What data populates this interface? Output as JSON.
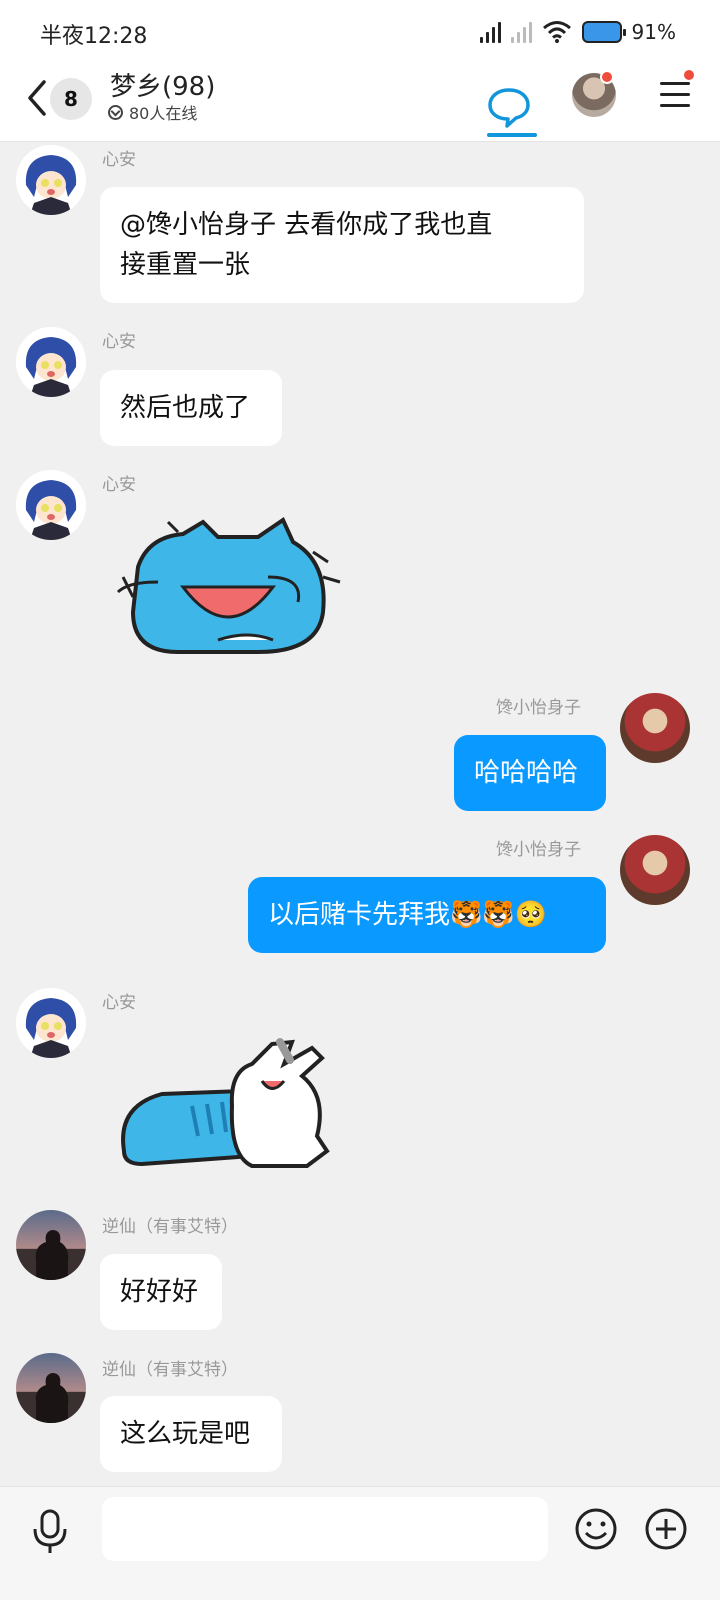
{
  "status": {
    "time": "半夜12:28",
    "battery": "91%"
  },
  "header": {
    "back_badge": "8",
    "title": "梦乡(98)",
    "online": "80人在线"
  },
  "messages": [
    {
      "sender": "心安",
      "text": "@馋小怡身子 去看你成了我也直接重置一张",
      "line1": "@馋小怡身子 去看你成了我也直",
      "line2": "接重置一张"
    },
    {
      "sender": "心安",
      "text": "然后也成了"
    },
    {
      "sender": "心安",
      "sticker": "blue-cat-laughing-sticker"
    },
    {
      "sender": "馋小怡身子",
      "text": "哈哈哈哈"
    },
    {
      "sender": "馋小怡身子",
      "text": "以后赌卡先拜我",
      "emojis": [
        "🐯",
        "🐯",
        "🥺"
      ]
    },
    {
      "sender": "心安",
      "sticker": "blue-cat-white-rabbit-sticker"
    },
    {
      "sender": "逆仙（有事艾特）",
      "text": "好好好"
    },
    {
      "sender": "逆仙（有事艾特）",
      "text": "这么玩是吧"
    }
  ],
  "input": {
    "placeholder": ""
  },
  "icons": {
    "back": "chevron-left-icon",
    "chat": "chat-bubble-icon",
    "menu": "menu-icon",
    "mic": "microphone-icon",
    "emoji": "smiley-icon",
    "plus": "plus-circle-icon"
  },
  "colors": {
    "accent": "#1296db",
    "my_bubble": "#0a99ff",
    "notify_dot": "#f04c3c",
    "bg": "#f0f0f0"
  }
}
